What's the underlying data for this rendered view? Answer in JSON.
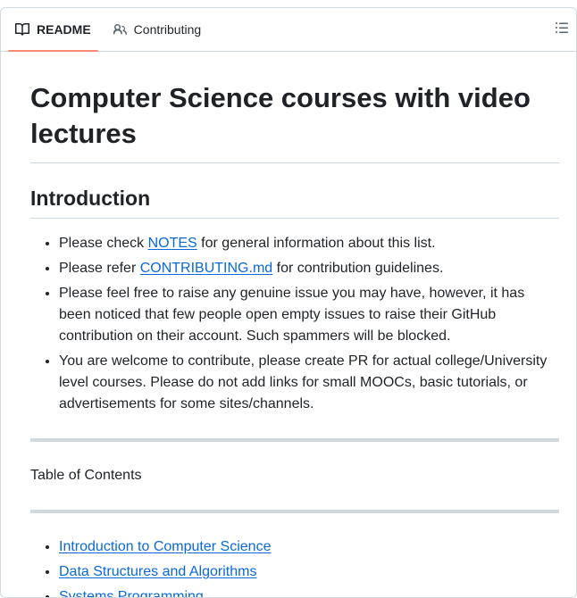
{
  "tabs": {
    "readme": "README",
    "contributing": "Contributing"
  },
  "article": {
    "title": "Computer Science courses with video lectures",
    "intro_heading": "Introduction",
    "items": [
      {
        "pre": "Please check ",
        "link": "NOTES",
        "post": " for general information about this list."
      },
      {
        "pre": "Please refer ",
        "link": "CONTRIBUTING.md",
        "post": " for contribution guidelines."
      },
      {
        "text": "Please feel free to raise any genuine issue you may have, however, it has been noticed that few people open empty issues to raise their GitHub contribution on their account. Such spammers will be blocked."
      },
      {
        "text": "You are welcome to contribute, please create PR for actual college/University level courses. Please do not add links for small MOOCs, basic tutorials, or advertisements for some sites/channels."
      }
    ],
    "toc_label": "Table of Contents",
    "toc": [
      "Introduction to Computer Science",
      "Data Structures and Algorithms",
      "Systems Programming"
    ]
  },
  "icons": {
    "readme": "book-icon",
    "contributing": "people-icon",
    "outline": "list-unordered-icon"
  }
}
